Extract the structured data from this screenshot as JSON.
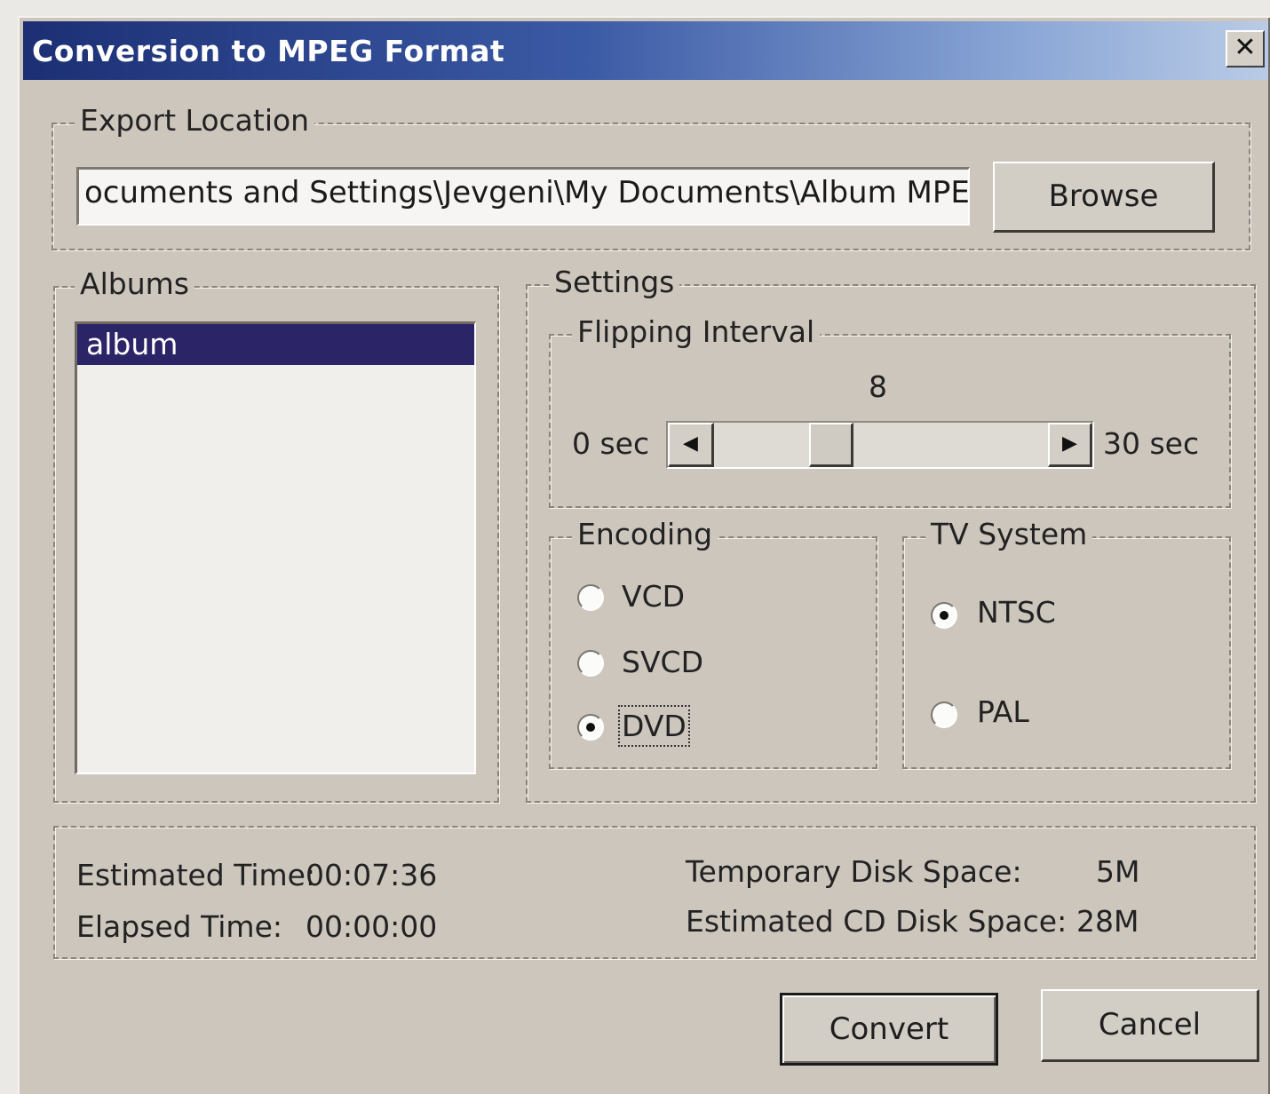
{
  "window": {
    "title": "Conversion to MPEG Format",
    "close_glyph": "✕"
  },
  "export": {
    "legend": "Export Location",
    "path": "ocuments and Settings\\Jevgeni\\My Documents\\Album MPEG",
    "browse_label": "Browse"
  },
  "albums": {
    "legend": "Albums",
    "items": [
      "album"
    ],
    "selected_index": 0
  },
  "settings": {
    "legend": "Settings",
    "flipping": {
      "legend": "Flipping Interval",
      "value": "8",
      "value_number": 8,
      "min_label": "0 sec",
      "max_label": "30 sec",
      "min": 0,
      "max": 30,
      "left_arrow": "◀",
      "right_arrow": "▶"
    },
    "encoding": {
      "legend": "Encoding",
      "options": [
        "VCD",
        "SVCD",
        "DVD"
      ],
      "selected": "DVD"
    },
    "tv_system": {
      "legend": "TV System",
      "options": [
        "NTSC",
        "PAL"
      ],
      "selected": "NTSC"
    }
  },
  "status": {
    "estimated_time_label": "Estimated Time:",
    "estimated_time_value": "00:07:36",
    "elapsed_time_label": "Elapsed Time:",
    "elapsed_time_value": "00:00:00",
    "temp_disk_label": "Temporary Disk Space:",
    "temp_disk_value": "5M",
    "cd_disk_label": "Estimated CD Disk Space:",
    "cd_disk_value": "28M"
  },
  "buttons": {
    "convert_label": "Convert",
    "cancel_label": "Cancel"
  },
  "colors": {
    "title_start": "#1c2f74",
    "title_end": "#b9cbe6",
    "selection": "#2b2466",
    "face": "#ccc6bd"
  }
}
